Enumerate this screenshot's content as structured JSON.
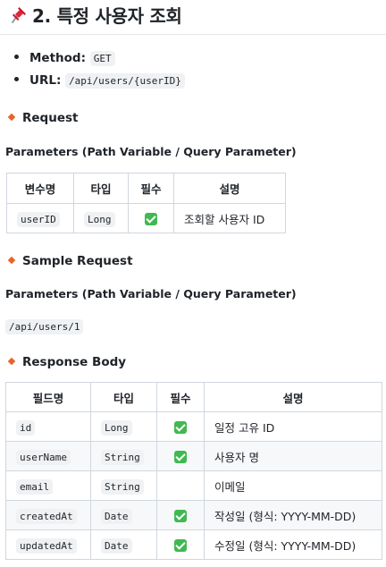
{
  "title": "2. 특정 사용자 조회",
  "method": {
    "label": "Method:",
    "value": "GET"
  },
  "url": {
    "label": "URL:",
    "value": "/api/users/{userID}"
  },
  "request": {
    "heading": "Request",
    "params_label": "Parameters (Path Variable / Query Parameter)",
    "table": {
      "headers": [
        "변수명",
        "타입",
        "필수",
        "설명"
      ],
      "rows": [
        {
          "name": "userID",
          "type": "Long",
          "required": true,
          "desc": "조회할 사용자 ID"
        }
      ]
    }
  },
  "sample": {
    "heading": "Sample Request",
    "params_label": "Parameters (Path Variable / Query Parameter)",
    "path": "/api/users/1"
  },
  "response": {
    "heading": "Response Body",
    "table": {
      "headers": [
        "필드명",
        "타입",
        "필수",
        "설명"
      ],
      "rows": [
        {
          "name": "id",
          "type": "Long",
          "required": true,
          "desc": "일정 고유 ID"
        },
        {
          "name": "userName",
          "type": "String",
          "required": true,
          "desc": "사용자 명"
        },
        {
          "name": "email",
          "type": "String",
          "required": false,
          "desc": "이메일"
        },
        {
          "name": "createdAt",
          "type": "Date",
          "required": true,
          "desc": "작성일 (형식: YYYY-MM-DD)"
        },
        {
          "name": "updatedAt",
          "type": "Date",
          "required": true,
          "desc": "수정일 (형식: YYYY-MM-DD)"
        }
      ]
    }
  },
  "icons": {
    "title": "pushpin-icon",
    "bullet": "bullet-dot",
    "section": "orange-diamond-icon",
    "required": "check-mark-button-icon"
  },
  "colors": {
    "diamond": "#e8642a",
    "check": "#3fb950",
    "code_bg": "#eff1f3",
    "border": "#d0d7de"
  }
}
